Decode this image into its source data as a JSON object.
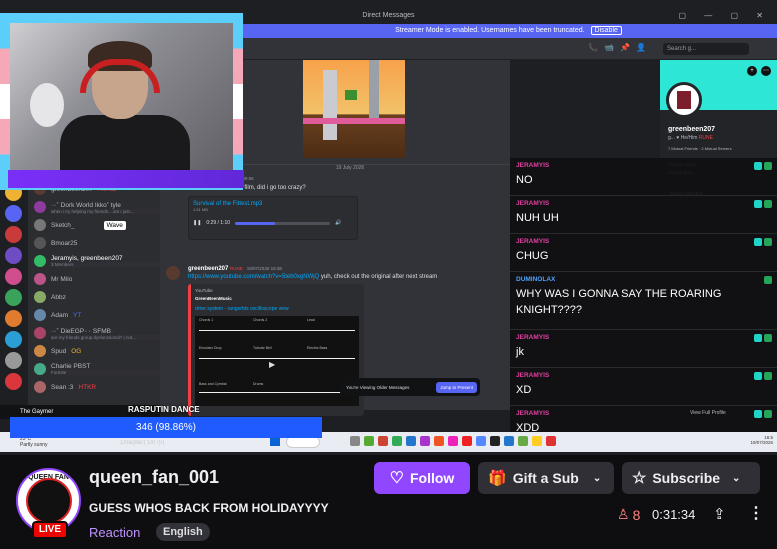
{
  "stream": {
    "titlebar": "Direct Messages",
    "window_controls": "▢ — ▢ ✕",
    "streamer_mode": "Streamer Mode is enabled. Usernames have been truncated.",
    "streamer_disable": "Disable",
    "search_placeholder": "Search g...",
    "dm_list": [
      {
        "name": "greenbeen207",
        "badge": "RUNE"
      },
      {
        "name": "·٠˚ Dork World Ikko˚",
        "badge": "tyle",
        "sub": "when i try helping my friends... am i just..."
      },
      {
        "name": "Sketch_",
        "badge": "Wave"
      },
      {
        "name": "Bmoar25"
      },
      {
        "name": "Jeramyis, greenbeen207",
        "sub": "3 Members"
      },
      {
        "name": "Mr Milo"
      },
      {
        "name": "Abbz"
      },
      {
        "name": "Adam",
        "badge": "YT"
      },
      {
        "name": "·٠˚ DieEGP٠٠",
        "badge": "SFMB",
        "sub": "are my friends group dysfunctional? | not..."
      },
      {
        "name": "Spud",
        "badge": "OG"
      },
      {
        "name": "Charlie",
        "badge": "PBST",
        "sub": "Fortnite"
      },
      {
        "name": "Sean :3",
        "badge": "HTKR"
      }
    ],
    "date_divider": "19 July 2026",
    "msg1": {
      "forwarded": "Forwarded",
      "time": "19/07/2026 09:56",
      "text": "made this for a short film, did i go too crazy?",
      "file_name": "Survival of the Fittest.mp3",
      "file_size": "1.61 MB",
      "time_played": "0:29 / 1:10",
      "progress": 0.42
    },
    "msg2": {
      "name": "greenbeen207",
      "badge": "RUNE",
      "time": "19/07/2026 16:38",
      "link": "https://www.youtube.com/watch?v=5teb0xgNWjQ",
      "text": " yuh, check out the original after next stream",
      "embed_provider": "YouTube",
      "embed_channel": "GreenBeenMusic",
      "embed_title": "drive system - rangerbts oscilloscope view",
      "wave_labels": [
        "Chords 1",
        "Chords 2",
        "Lead",
        "Emulator Drop",
        "Tubular Bell",
        "Electric Bass",
        "Bass and Cymbal",
        "Drums"
      ]
    },
    "older": {
      "text": "You're Viewing Older Messages",
      "button": "Jump to Present"
    },
    "profile": {
      "username": "greenbeen207",
      "pronouns": "g... ♥ He/Him",
      "rune": "RUNE",
      "mutual": "7 Mutual Friends · 2 Mutual Servers",
      "member_since_label": "Member Since",
      "member_since": "29 Oct 2024",
      "collection": "Game Collection",
      "view_full": "View Full Profile"
    },
    "overlay_chat": [
      {
        "user": "JERAMYIS",
        "text": "NO"
      },
      {
        "user": "JERAMYIS",
        "text": "NUH UH"
      },
      {
        "user": "JERAMYIS",
        "text": "CHUG"
      },
      {
        "user": "DUMINOLAX",
        "text": "WHY WAS I GONNA SAY THE ROARING KNIGHT????"
      },
      {
        "user": "JERAMYIS",
        "text": "jk"
      },
      {
        "user": "JERAMYIS",
        "text": "XD"
      },
      {
        "user": "JERAMYIS",
        "text": "XDD"
      }
    ],
    "gaymer": "The Gaymer",
    "poll": {
      "question": "RASPUTIN DANCE",
      "result": "346 (98.86%)",
      "share": 0.9886
    },
    "taskbar": {
      "weather_temp": "23°C",
      "weather_desc": "Partly sunny",
      "clock_time": "16:5",
      "clock_date": "19/07/2026"
    },
    "blur_row": "1/0&(8&/) 1/0 /)/)"
  },
  "channel": {
    "avatar_text": "QUEEN FAN",
    "live": "LIVE",
    "name": "queen_fan_001",
    "title": "GUESS WHOS BACK FROM HOLIDAYYYY",
    "category": "Reaction",
    "language": "English",
    "follow": "Follow",
    "gift": "Gift a Sub",
    "subscribe": "Subscribe",
    "viewers": "8",
    "uptime": "0:31:34"
  },
  "colors": {
    "twitch_purple": "#9147ff",
    "discord_blurple": "#5865f2",
    "live_red": "#eb0400",
    "chat_pink": "#e040a0"
  }
}
